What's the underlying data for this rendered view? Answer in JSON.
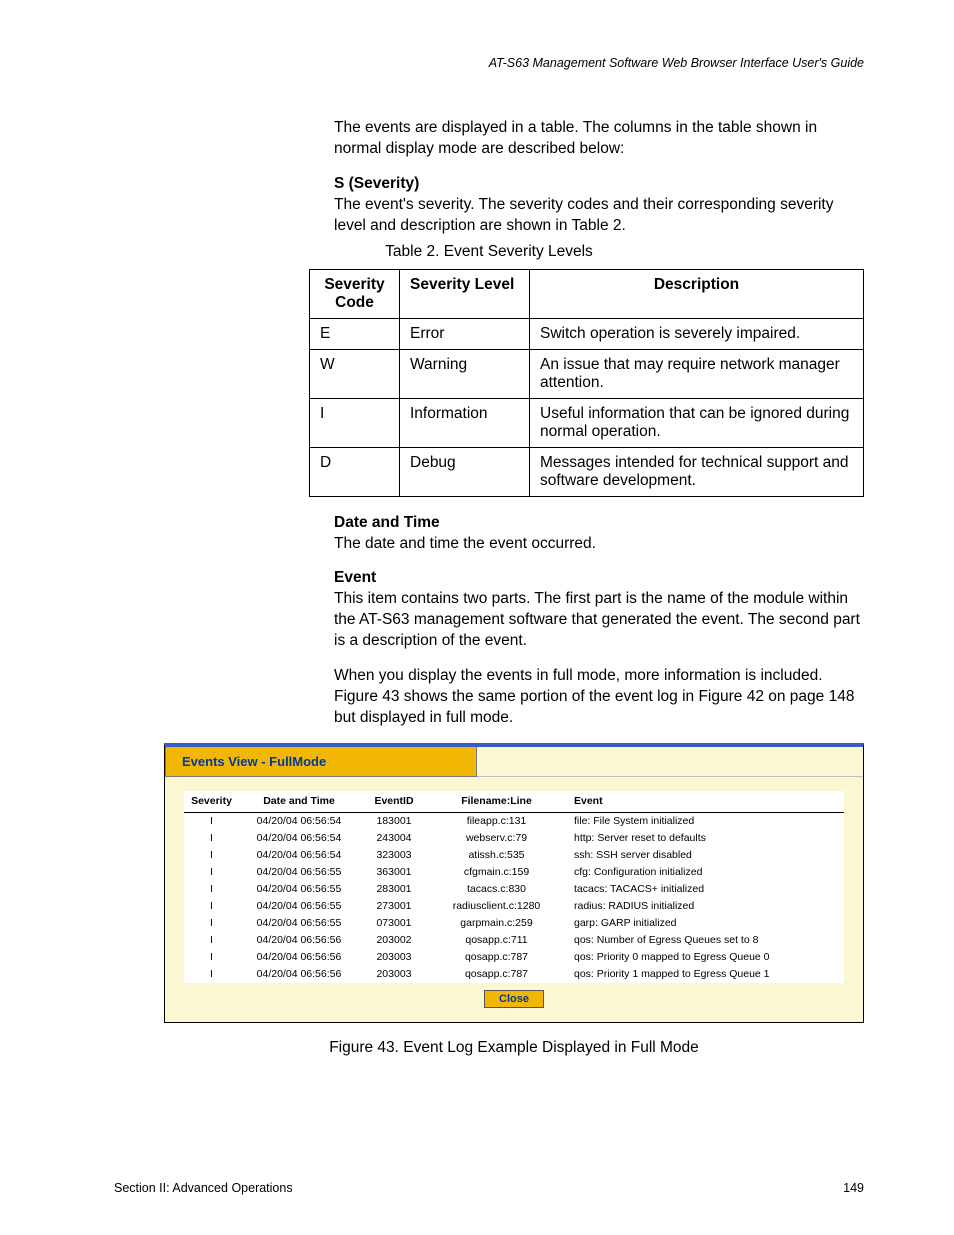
{
  "header": {
    "running_head": "AT-S63 Management Software Web Browser Interface User's Guide"
  },
  "intro": "The events are displayed in a table. The columns in the table shown in normal display mode are described below:",
  "severity_section": {
    "heading": "S (Severity)",
    "text": "The event's severity. The severity codes and their corresponding severity level and description are shown in Table 2.",
    "table_caption": "Table 2. Event Severity Levels",
    "columns": [
      "Severity Code",
      "Severity Level",
      "Description"
    ],
    "rows": [
      {
        "code": "E",
        "level": "Error",
        "desc": "Switch operation is severely impaired."
      },
      {
        "code": "W",
        "level": "Warning",
        "desc": "An issue that may require network manager attention."
      },
      {
        "code": "I",
        "level": "Information",
        "desc": "Useful information that can be ignored during normal operation."
      },
      {
        "code": "D",
        "level": "Debug",
        "desc": "Messages intended for technical support and software development."
      }
    ]
  },
  "datetime_section": {
    "heading": "Date and Time",
    "text": "The date and time the event occurred."
  },
  "event_section": {
    "heading": "Event",
    "para1": "This item contains two parts. The first part is the name of the module within the AT-S63 management software that generated the event. The second part is a description of the event.",
    "para2": "When you display the events in full mode, more information is included. Figure 43 shows the same portion of the event log in Figure 42 on page 148 but displayed in full mode."
  },
  "figure": {
    "tab_title": "Events View - FullMode",
    "columns": [
      "Severity",
      "Date and Time",
      "EventID",
      "Filename:Line",
      "Event"
    ],
    "rows": [
      {
        "s": "I",
        "dt": "04/20/04 06:56:54",
        "eid": "183001",
        "fl": "fileapp.c:131",
        "ev": "file: File System initialized"
      },
      {
        "s": "I",
        "dt": "04/20/04 06:56:54",
        "eid": "243004",
        "fl": "webserv.c:79",
        "ev": "http: Server reset to defaults"
      },
      {
        "s": "I",
        "dt": "04/20/04 06:56:54",
        "eid": "323003",
        "fl": "atissh.c:535",
        "ev": "ssh: SSH server disabled"
      },
      {
        "s": "I",
        "dt": "04/20/04 06:56:55",
        "eid": "363001",
        "fl": "cfgmain.c:159",
        "ev": "cfg: Configuration initialized"
      },
      {
        "s": "I",
        "dt": "04/20/04 06:56:55",
        "eid": "283001",
        "fl": "tacacs.c:830",
        "ev": "tacacs: TACACS+ initialized"
      },
      {
        "s": "I",
        "dt": "04/20/04 06:56:55",
        "eid": "273001",
        "fl": "radiusclient.c:1280",
        "ev": "radius: RADIUS initialized"
      },
      {
        "s": "I",
        "dt": "04/20/04 06:56:55",
        "eid": "073001",
        "fl": "garpmain.c:259",
        "ev": "garp: GARP initialized"
      },
      {
        "s": "I",
        "dt": "04/20/04 06:56:56",
        "eid": "203002",
        "fl": "qosapp.c:711",
        "ev": "qos: Number of Egress Queues set to 8"
      },
      {
        "s": "I",
        "dt": "04/20/04 06:56:56",
        "eid": "203003",
        "fl": "qosapp.c:787",
        "ev": "qos: Priority 0 mapped to Egress Queue 0"
      },
      {
        "s": "I",
        "dt": "04/20/04 06:56:56",
        "eid": "203003",
        "fl": "qosapp.c:787",
        "ev": "qos: Priority 1 mapped to Egress Queue 1"
      }
    ],
    "close_label": "Close",
    "caption": "Figure 43. Event Log Example Displayed in Full Mode"
  },
  "footer": {
    "section": "Section II: Advanced Operations",
    "page": "149"
  }
}
